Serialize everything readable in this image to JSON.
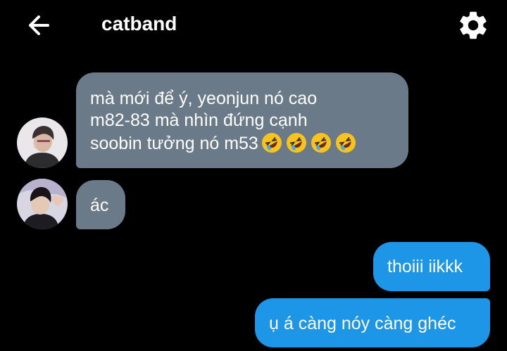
{
  "header": {
    "title": "catband",
    "back_icon": "arrow-left-icon",
    "settings_icon": "gear-icon"
  },
  "messages": [
    {
      "direction": "incoming",
      "lines": [
        "mà mới để ý, yeonjun nó cao",
        "m82-83 mà nhìn đứng cạnh",
        "soobin tưởng nó m53"
      ],
      "emoji": "rolling-on-floor-laughing",
      "emoji_count": 4,
      "avatar": "avatar-boy-peace-sign"
    },
    {
      "direction": "incoming",
      "lines": [
        "ác"
      ],
      "avatar": "avatar-boy-heart-hands"
    },
    {
      "direction": "outgoing",
      "lines": [
        "thoiii iikkk"
      ]
    },
    {
      "direction": "outgoing",
      "lines": [
        "ụ á càng nóy càng ghéc"
      ]
    }
  ],
  "colors": {
    "background": "#000000",
    "incoming_bubble": "#6b7a89",
    "outgoing_bubble": "#1e96e8",
    "text": "#ffffff"
  }
}
